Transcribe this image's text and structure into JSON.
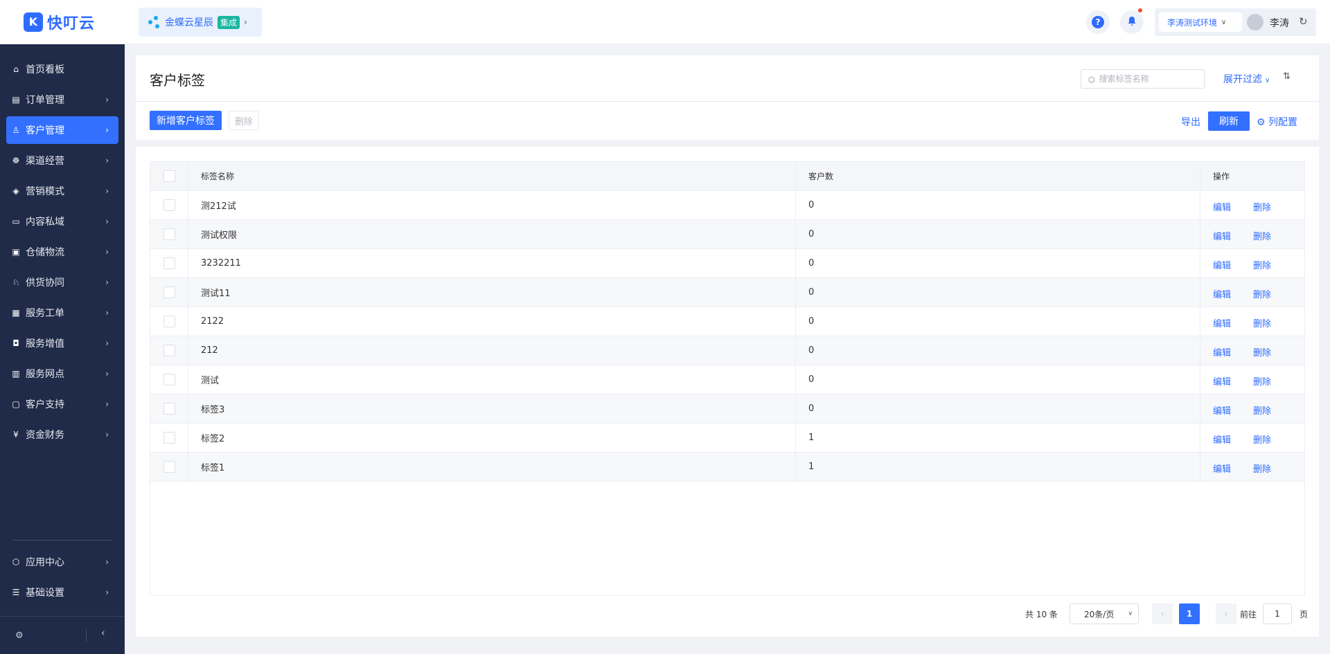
{
  "brand": {
    "logo_glyph": "K",
    "name": "快叮云"
  },
  "header": {
    "chip_name": "金蝶云星辰",
    "chip_badge": "集成",
    "help_glyph": "?",
    "environment": "李涛测试环境",
    "user_name": "李涛"
  },
  "sidebar": {
    "items": [
      {
        "label": "首页看板",
        "icon": "home-icon",
        "has_chevron": false
      },
      {
        "label": "订单管理",
        "icon": "order-icon",
        "has_chevron": true
      },
      {
        "label": "客户管理",
        "icon": "user-icon",
        "has_chevron": true,
        "active": true
      },
      {
        "label": "渠道经营",
        "icon": "channel-icon",
        "has_chevron": true
      },
      {
        "label": "营销模式",
        "icon": "tag-icon",
        "has_chevron": true
      },
      {
        "label": "内容私域",
        "icon": "image-icon",
        "has_chevron": true
      },
      {
        "label": "仓储物流",
        "icon": "warehouse-icon",
        "has_chevron": true
      },
      {
        "label": "供货协同",
        "icon": "supply-icon",
        "has_chevron": true
      },
      {
        "label": "服务工单",
        "icon": "ticket-icon",
        "has_chevron": true
      },
      {
        "label": "服务增值",
        "icon": "bag-icon",
        "has_chevron": true
      },
      {
        "label": "服务网点",
        "icon": "store-icon",
        "has_chevron": true
      },
      {
        "label": "客户支持",
        "icon": "support-icon",
        "has_chevron": true
      },
      {
        "label": "资金财务",
        "icon": "yuan-icon",
        "has_chevron": true
      }
    ],
    "bottom_items": [
      {
        "label": "应用中心",
        "icon": "cube-icon",
        "has_chevron": true
      },
      {
        "label": "基础设置",
        "icon": "settings-list-icon",
        "has_chevron": true
      }
    ]
  },
  "page": {
    "title": "客户标签",
    "search_placeholder": "搜索标签名称",
    "expand_filter": "展开过滤",
    "add_button": "新增客户标签",
    "delete_button": "删除",
    "export_button": "导出",
    "refresh_button": "刷新",
    "column_config_button": "列配置"
  },
  "table": {
    "headers": {
      "name": "标签名称",
      "count": "客户数",
      "ops": "操作"
    },
    "rows": [
      {
        "name": "测212试",
        "count": "0"
      },
      {
        "name": "测试权限",
        "count": "0"
      },
      {
        "name": "3232211",
        "count": "0"
      },
      {
        "name": "测试11",
        "count": "0"
      },
      {
        "name": "2122",
        "count": "0"
      },
      {
        "name": "212",
        "count": "0"
      },
      {
        "name": "测试",
        "count": "0"
      },
      {
        "name": "标签3",
        "count": "0"
      },
      {
        "name": "标签2",
        "count": "1"
      },
      {
        "name": "标签1",
        "count": "1"
      }
    ],
    "edit_label": "编辑",
    "delete_label": "删除"
  },
  "pagination": {
    "total": "共 10 条",
    "page_size": "20条/页",
    "current_page": "1",
    "goto_label": "前往",
    "goto_value": "1",
    "page_suffix": "页"
  },
  "colors": {
    "primary": "#3370ff",
    "sidebar_bg": "#1f2b48"
  }
}
